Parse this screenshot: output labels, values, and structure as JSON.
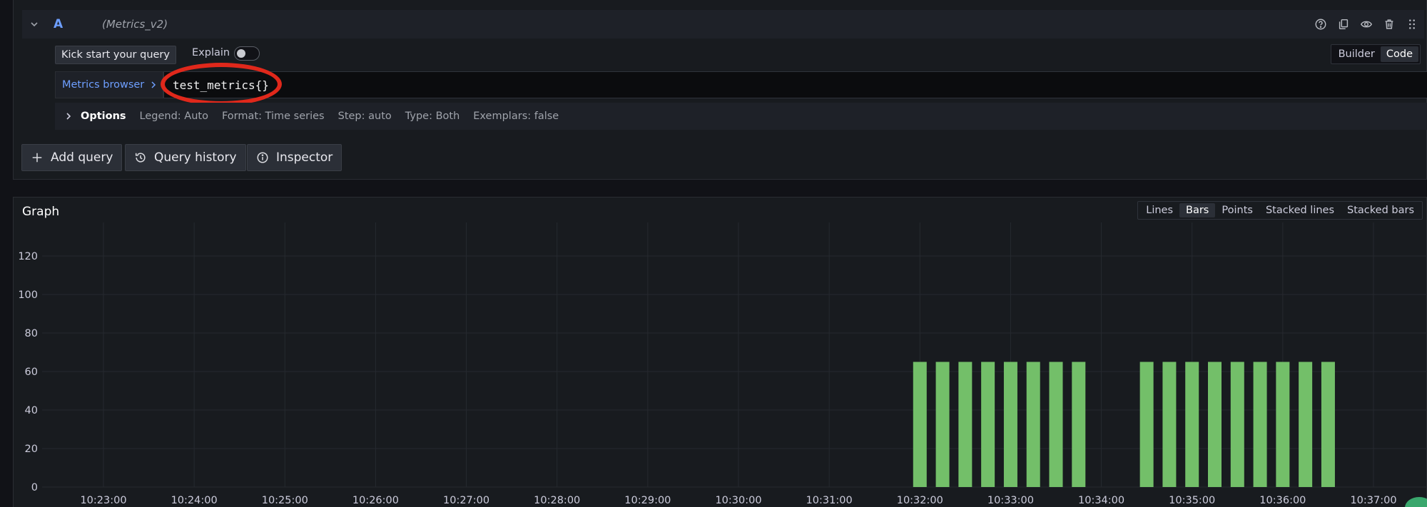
{
  "query": {
    "ref_id": "A",
    "datasource": "(Metrics_v2)",
    "kick_start_label": "Kick start your query",
    "explain_label": "Explain",
    "explain_on": false,
    "modes": [
      "Builder",
      "Code"
    ],
    "active_mode": "Code",
    "metrics_browser_label": "Metrics browser",
    "expression": "test_metrics{}",
    "options": {
      "title": "Options",
      "legend": "Legend: Auto",
      "format": "Format: Time series",
      "step": "Step: auto",
      "type": "Type: Both",
      "exemplars": "Exemplars: false"
    },
    "header_icons": [
      "help-icon",
      "duplicate-icon",
      "eye-icon",
      "trash-icon",
      "drag-handle-icon"
    ]
  },
  "actions": {
    "add_query": "Add query",
    "query_history": "Query history",
    "inspector": "Inspector"
  },
  "graph": {
    "title": "Graph",
    "modes": [
      "Lines",
      "Bars",
      "Points",
      "Stacked lines",
      "Stacked bars"
    ],
    "active_mode": "Bars"
  },
  "chart_data": {
    "type": "bar",
    "title": "",
    "xlabel": "",
    "ylabel": "",
    "ylim": [
      0,
      130
    ],
    "yticks": [
      0,
      20,
      40,
      60,
      80,
      100,
      120
    ],
    "xlim": [
      "10:22:00",
      "10:37:30"
    ],
    "xticks": [
      "10:23:00",
      "10:24:00",
      "10:25:00",
      "10:26:00",
      "10:27:00",
      "10:28:00",
      "10:29:00",
      "10:30:00",
      "10:31:00",
      "10:32:00",
      "10:33:00",
      "10:34:00",
      "10:35:00",
      "10:36:00",
      "10:37:00"
    ],
    "grid": true,
    "bar_color": "#73bf69",
    "series": [
      {
        "x": [
          "10:32:00",
          "10:32:15",
          "10:32:30",
          "10:32:45",
          "10:33:00",
          "10:33:15",
          "10:33:30",
          "10:33:45",
          "10:34:30",
          "10:34:45",
          "10:35:00",
          "10:35:15",
          "10:35:30",
          "10:35:45",
          "10:36:00",
          "10:36:15",
          "10:36:30"
        ],
        "values": [
          65,
          65,
          65,
          65,
          65,
          65,
          65,
          65,
          65,
          65,
          65,
          65,
          65,
          65,
          65,
          65,
          65
        ]
      }
    ]
  }
}
